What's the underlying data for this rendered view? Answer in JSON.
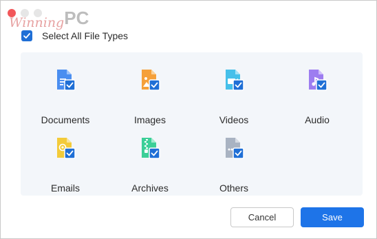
{
  "header": {
    "watermark_text": "Winning",
    "watermark_suffix": "PC"
  },
  "select_all": {
    "label": "Select All File Types",
    "checked": true
  },
  "file_types": [
    {
      "label": "Documents",
      "icon": "document-icon",
      "color": "#4a8ef0",
      "checked": true
    },
    {
      "label": "Images",
      "icon": "image-icon",
      "color": "#f5a03a",
      "checked": true
    },
    {
      "label": "Videos",
      "icon": "video-icon",
      "color": "#46c0ea",
      "checked": true
    },
    {
      "label": "Audio",
      "icon": "audio-icon",
      "color": "#9d7df0",
      "checked": true
    },
    {
      "label": "Emails",
      "icon": "email-icon",
      "color": "#f3cb3a",
      "checked": true
    },
    {
      "label": "Archives",
      "icon": "archive-icon",
      "color": "#3ccf98",
      "checked": true
    },
    {
      "label": "Others",
      "icon": "other-file-icon",
      "color": "#a9b3c2",
      "checked": true
    }
  ],
  "buttons": {
    "cancel": "Cancel",
    "save": "Save"
  },
  "colors": {
    "accent": "#1e74e8",
    "check": "#1f6fd6",
    "panel_bg": "#f3f6fa"
  }
}
